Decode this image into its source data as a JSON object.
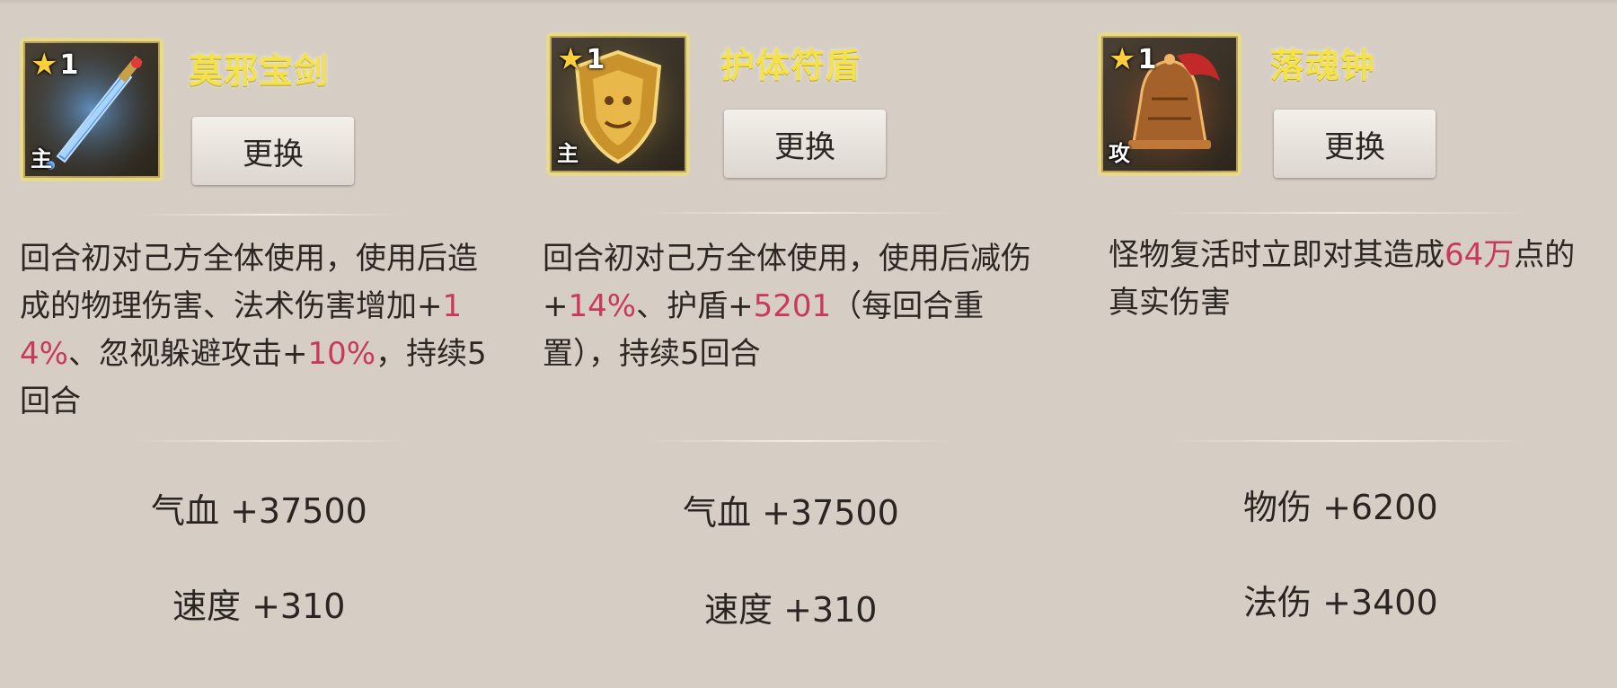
{
  "colors": {
    "name": "#f3e24a",
    "highlight": "#c83a59",
    "background": "#d6cec5",
    "frame": "#e9d98a"
  },
  "cards": [
    {
      "name": "莫邪宝剑",
      "star": "1",
      "role": "主",
      "icon": "sword-icon",
      "button": "更换",
      "desc": [
        {
          "t": "回合初对己方全体使用，使用后造成的物理伤害、法术伤害增加+",
          "h": false
        },
        {
          "t": "14%",
          "h": true
        },
        {
          "t": "、忽视躲避攻击+",
          "h": false
        },
        {
          "t": "10%",
          "h": true
        },
        {
          "t": "，持续5回合",
          "h": false
        }
      ],
      "stats": [
        "气血 +37500",
        "速度 +310"
      ]
    },
    {
      "name": "护体符盾",
      "star": "1",
      "role": "主",
      "icon": "shield-icon",
      "button": "更换",
      "desc": [
        {
          "t": "回合初对己方全体使用，使用后减伤+",
          "h": false
        },
        {
          "t": "14%",
          "h": true
        },
        {
          "t": "、护盾+",
          "h": false
        },
        {
          "t": "5201",
          "h": true
        },
        {
          "t": "（每回合重置），持续5回合",
          "h": false
        }
      ],
      "stats": [
        "气血 +37500",
        "速度 +310"
      ]
    },
    {
      "name": "落魂钟",
      "star": "1",
      "role": "攻",
      "icon": "bell-icon",
      "button": "更换",
      "desc": [
        {
          "t": "怪物复活时立即对其造成",
          "h": false
        },
        {
          "t": "64万",
          "h": true
        },
        {
          "t": "点的真实伤害",
          "h": false
        }
      ],
      "stats": [
        "物伤 +6200",
        "法伤 +3400"
      ]
    }
  ]
}
